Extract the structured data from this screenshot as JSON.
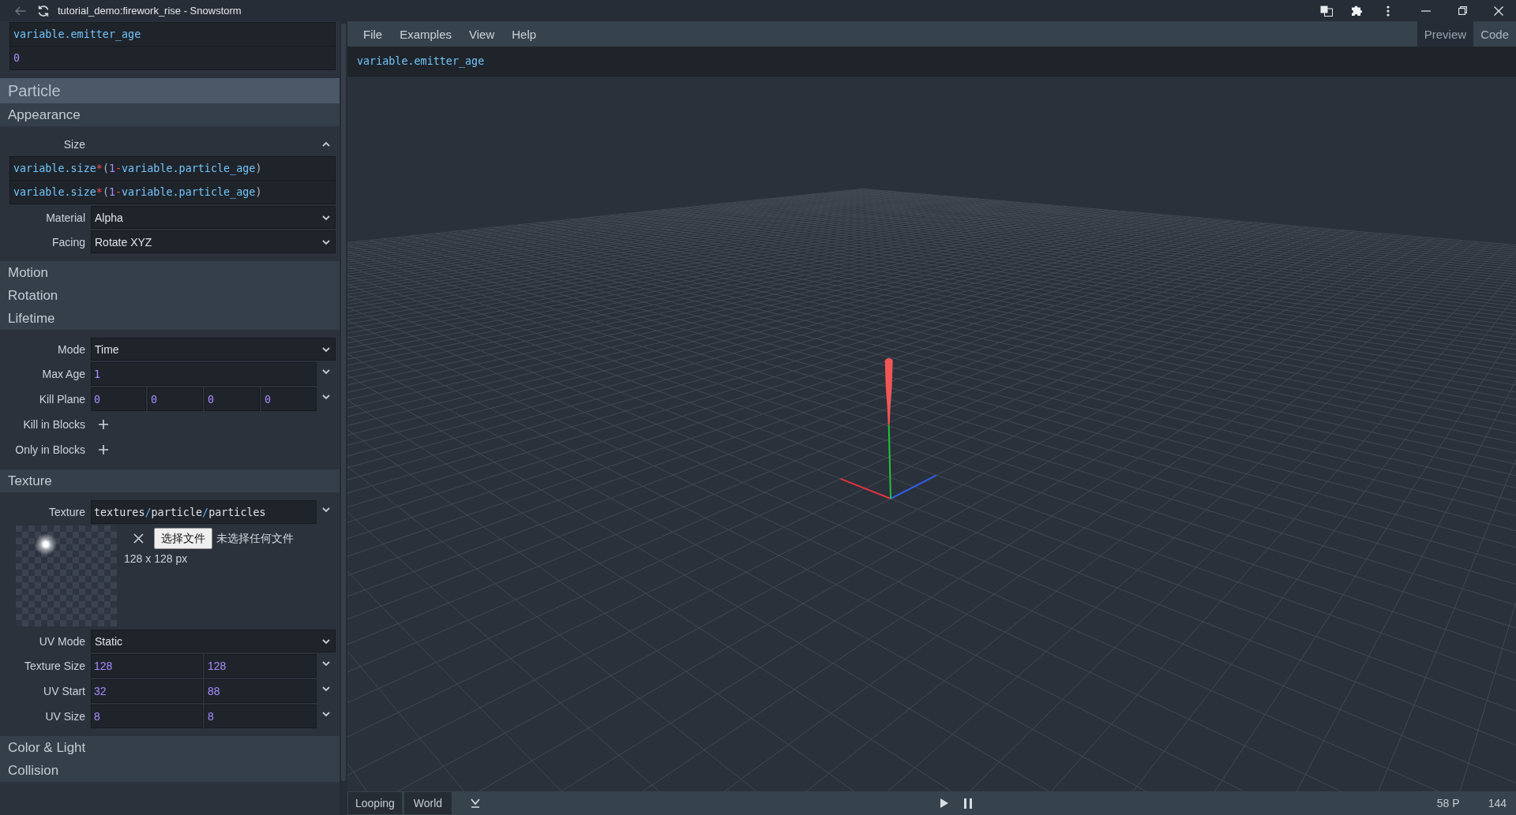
{
  "window": {
    "title": "tutorial_demo:firework_rise - Snowstorm"
  },
  "sidebar": {
    "top_expressions": [
      "variable.emitter_age",
      "0"
    ],
    "sections": [
      {
        "title": "Particle",
        "kind": "category"
      },
      {
        "title": "Appearance",
        "kind": "panel",
        "fields": [
          {
            "kind": "expression_group",
            "label": "Size",
            "expanded": true,
            "lines": [
              "variable.size*(1-variable.particle_age)",
              "variable.size*(1-variable.particle_age)"
            ]
          },
          {
            "kind": "select",
            "label": "Material",
            "value": "Alpha"
          },
          {
            "kind": "select",
            "label": "Facing",
            "value": "Rotate XYZ"
          }
        ]
      },
      {
        "title": "Motion",
        "kind": "panel"
      },
      {
        "title": "Rotation",
        "kind": "panel"
      },
      {
        "title": "Lifetime",
        "kind": "panel",
        "fields": [
          {
            "kind": "select",
            "label": "Mode",
            "value": "Time"
          },
          {
            "kind": "molang",
            "label": "Max Age",
            "values": [
              "1"
            ]
          },
          {
            "kind": "molang",
            "label": "Kill Plane",
            "values": [
              "0",
              "0",
              "0",
              "0"
            ]
          },
          {
            "kind": "add",
            "label": "Kill in Blocks"
          },
          {
            "kind": "add",
            "label": "Only in Blocks"
          }
        ]
      },
      {
        "title": "Texture",
        "kind": "panel",
        "fields": [
          {
            "kind": "text",
            "label": "Texture",
            "values": [
              "textures/particle/particles"
            ]
          },
          {
            "kind": "image",
            "button": "选择文件",
            "file_status": "未选择任何文件",
            "size": "128 x 128 px"
          },
          {
            "kind": "select",
            "label": "UV Mode",
            "value": "Static"
          },
          {
            "kind": "number",
            "label": "Texture Size",
            "values": [
              "128",
              "128"
            ]
          },
          {
            "kind": "number",
            "label": "UV Start",
            "values": [
              "32",
              "88"
            ]
          },
          {
            "kind": "number",
            "label": "UV Size",
            "values": [
              "8",
              "8"
            ]
          }
        ]
      },
      {
        "title": "Color & Light",
        "kind": "panel"
      },
      {
        "title": "Collision",
        "kind": "panel"
      }
    ]
  },
  "menu": [
    "File",
    "Examples",
    "View",
    "Help"
  ],
  "tabs": [
    {
      "label": "Preview",
      "selected": true
    },
    {
      "label": "Code",
      "selected": false
    }
  ],
  "expression_bar": "variable.emitter_age",
  "status_bar": {
    "buttons": [
      "Looping",
      "World"
    ],
    "particle_count": "58 P",
    "fps": "144"
  }
}
